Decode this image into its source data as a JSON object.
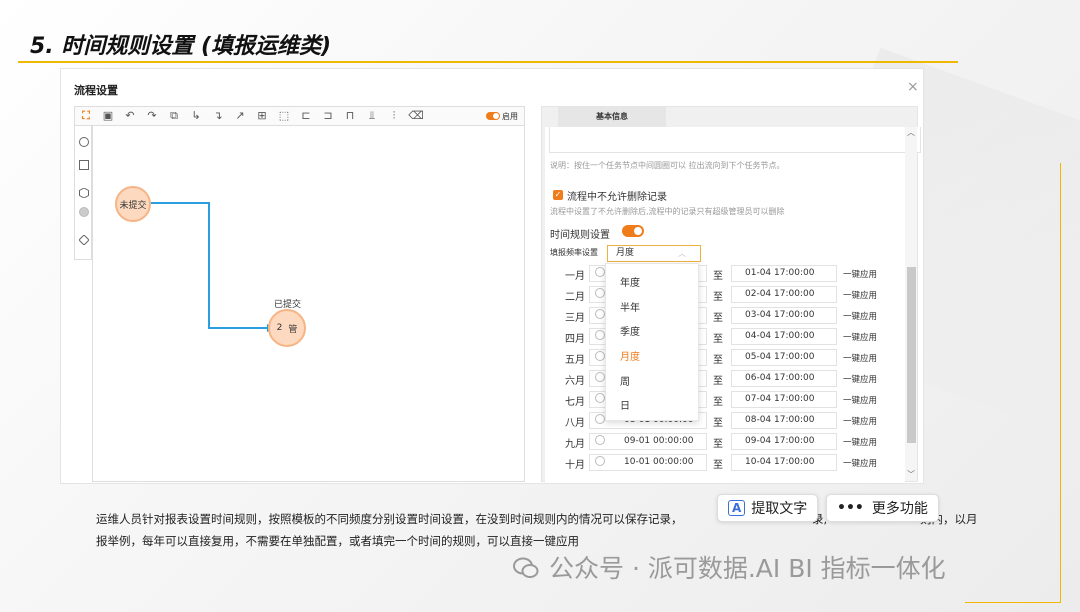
{
  "slide": {
    "title": "5. 时间规则设置 (填报运维类)"
  },
  "dialog": {
    "title": "流程设置",
    "close": "×",
    "toolbar": {
      "icons": [
        "select-icon",
        "save-icon",
        "undo-icon",
        "redo-icon",
        "copy-icon",
        "connector-icon",
        "connector2-icon",
        "arrow-icon",
        "grid-icon",
        "marquee-icon",
        "align-left-icon",
        "align-right-icon",
        "align-top-icon",
        "align-bottom-icon",
        "distribute-icon",
        "delete-icon"
      ],
      "toggle_label": "启用"
    },
    "palette": [
      "circle",
      "square",
      "hexagon",
      "gray-circle",
      "diamond"
    ],
    "canvas": {
      "node1": "未提交",
      "node2_label": "已提交",
      "node2_text": "2",
      "node2_sub": "管"
    },
    "panel": {
      "tab": "基本信息",
      "hint_desc": "说明：按住一个任务节点中间圆圈可以 拉出流向到下个任务节点。",
      "no_delete_label": "流程中不允许删除记录",
      "no_delete_hint": "流程中设置了不允许删除后,流程中的记录只有超级管理员可以删除",
      "time_rule_label": "时间规则设置",
      "freq_label": "填报频率设置",
      "freq_value": "月度",
      "to_text": "至",
      "apply_text": "一键应用",
      "rows": [
        {
          "month": "一月",
          "start": "",
          "end": "01-04 17:00:00"
        },
        {
          "month": "二月",
          "start": "",
          "end": "02-04 17:00:00"
        },
        {
          "month": "三月",
          "start": "",
          "end": "03-04 17:00:00"
        },
        {
          "month": "四月",
          "start": "",
          "end": "04-04 17:00:00"
        },
        {
          "month": "五月",
          "start": "",
          "end": "05-04 17:00:00"
        },
        {
          "month": "六月",
          "start": "",
          "end": "06-04 17:00:00"
        },
        {
          "month": "七月",
          "start": "",
          "end": "07-04 17:00:00"
        },
        {
          "month": "八月",
          "start": "08-01 00:00:00",
          "end": "08-04 17:00:00"
        },
        {
          "month": "九月",
          "start": "09-01 00:00:00",
          "end": "09-04 17:00:00"
        },
        {
          "month": "十月",
          "start": "10-01 00:00:00",
          "end": "10-04 17:00:00"
        }
      ]
    },
    "dropdown": {
      "options": [
        "年度",
        "半年",
        "季度",
        "月度",
        "周",
        "日"
      ],
      "selected": "月度"
    }
  },
  "caption": {
    "line1a": "运维人员针对报表设置时间规则，按照模板的不同频度分别设置时间设置，在没到时间规则内的情况可以保存记录，",
    "line1b": "录,",
    "line1c": "则内，以月",
    "line2": "报举例，每年可以直接复用，不需要在单独配置，或者填完一个时间的规则，可以直接一键应用"
  },
  "floating": {
    "extract_text": "提取文字",
    "more": "更多功能"
  },
  "watermark": {
    "text": "公众号 · 派可数据.AI BI 指标一体化"
  },
  "colors": {
    "accent": "#f07d1c",
    "title_line": "#f0b800",
    "connector": "#2a9fe0"
  }
}
